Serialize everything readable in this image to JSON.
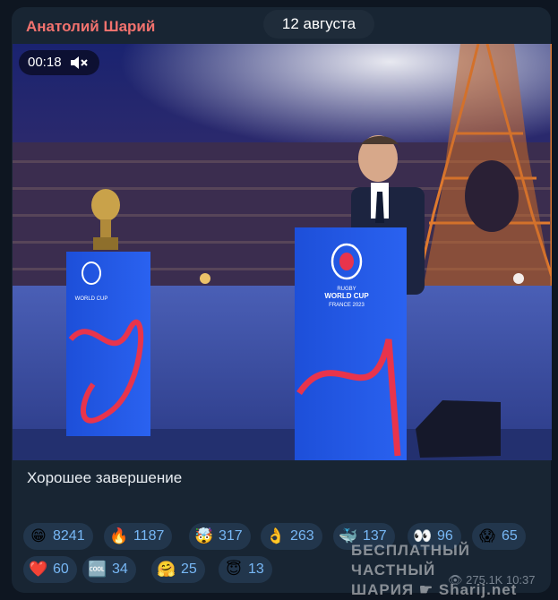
{
  "message": {
    "sender": "Анатолий Шарий",
    "date_badge": "12 августа",
    "caption": "Хорошее завершение"
  },
  "video": {
    "duration": "00:18",
    "mute_icon": "volume-muted-icon",
    "podium_text_1": "RUGBY",
    "podium_text_2": "WORLD CUP",
    "podium_text_3": "FRANCE 2023"
  },
  "reactions": [
    {
      "emoji": "😁",
      "name": "grinning-face",
      "count": "8241"
    },
    {
      "emoji": "🔥",
      "name": "fire",
      "count": "1187"
    },
    {
      "emoji": "🤯",
      "name": "exploding-head",
      "count": "317"
    },
    {
      "emoji": "👌",
      "name": "ok-hand",
      "count": "263"
    },
    {
      "emoji": "🐳",
      "name": "whale",
      "count": "137"
    },
    {
      "emoji": "👀",
      "name": "eyes",
      "count": "96"
    },
    {
      "emoji": "😱",
      "name": "screaming-face",
      "count": "65"
    },
    {
      "emoji": "❤️",
      "name": "red-heart",
      "count": "60"
    },
    {
      "emoji": "🆒",
      "name": "cool-button",
      "count": "34"
    },
    {
      "emoji": "🤗",
      "name": "hugging-face",
      "count": "25"
    },
    {
      "emoji": "😇",
      "name": "angel-face",
      "count": "13"
    }
  ],
  "watermark": {
    "line1": "БЕСПЛАТНЫЙ ЧАСТНЫЙ",
    "line2": "ШАРИЯ",
    "line3": "Sharij.net"
  },
  "footer": {
    "views": "275.1K",
    "time": "10:37"
  },
  "colors": {
    "background": "#0e1621",
    "bubble": "#182533",
    "sender": "#f2726e",
    "reaction_bg": "#22364c",
    "reaction_text": "#77b7f5"
  }
}
